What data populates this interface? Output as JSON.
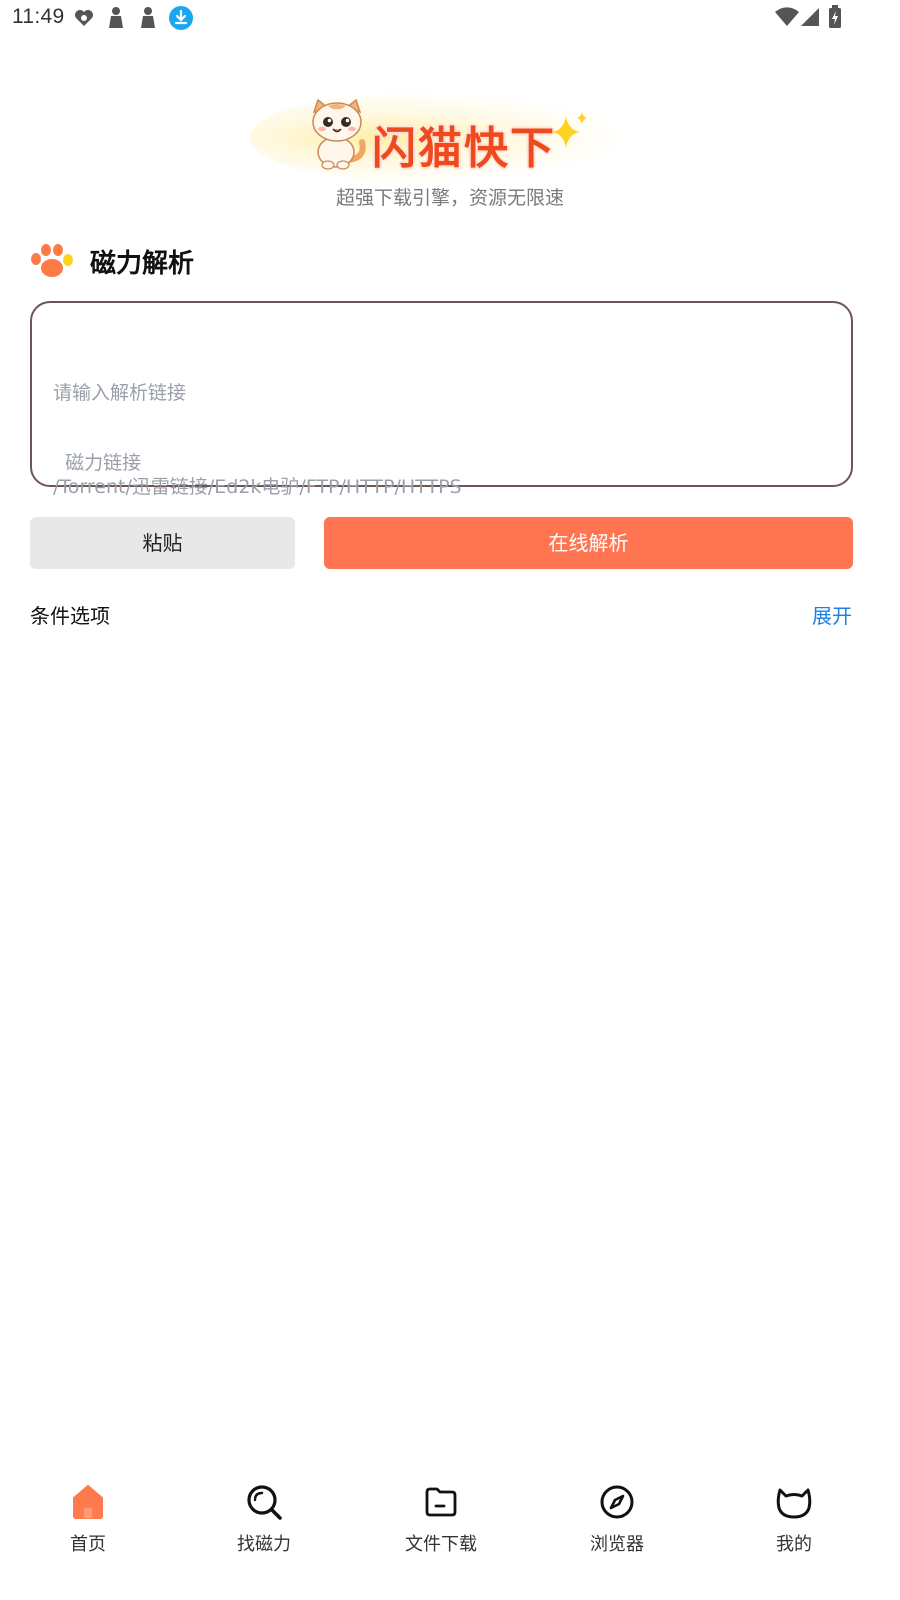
{
  "status_bar": {
    "time": "11:49"
  },
  "logo": {
    "app_name": "闪猫快下",
    "slogan": "超强下载引擎，资源无限速"
  },
  "section": {
    "title": "磁力解析"
  },
  "input": {
    "placeholder_line1": "请输入解析链接",
    "placeholder_line2": "磁力链接\n/Torrent/迅雷链接/Ed2k电驴/FTP/HTTP/HTTPS",
    "value": ""
  },
  "buttons": {
    "paste": "粘贴",
    "parse": "在线解析"
  },
  "options": {
    "label": "条件选项",
    "expand": "展开"
  },
  "nav": {
    "items": [
      {
        "label": "首页",
        "icon": "home-icon",
        "active": true
      },
      {
        "label": "找磁力",
        "icon": "search-icon",
        "active": false
      },
      {
        "label": "文件下载",
        "icon": "folder-icon",
        "active": false
      },
      {
        "label": "浏览器",
        "icon": "compass-icon",
        "active": false
      },
      {
        "label": "我的",
        "icon": "cat-head-icon",
        "active": false
      }
    ]
  },
  "colors": {
    "accent": "#ff7552",
    "logo_red": "#ef4a1e",
    "link_blue": "#1f7fe0",
    "input_border": "#6e5653"
  }
}
